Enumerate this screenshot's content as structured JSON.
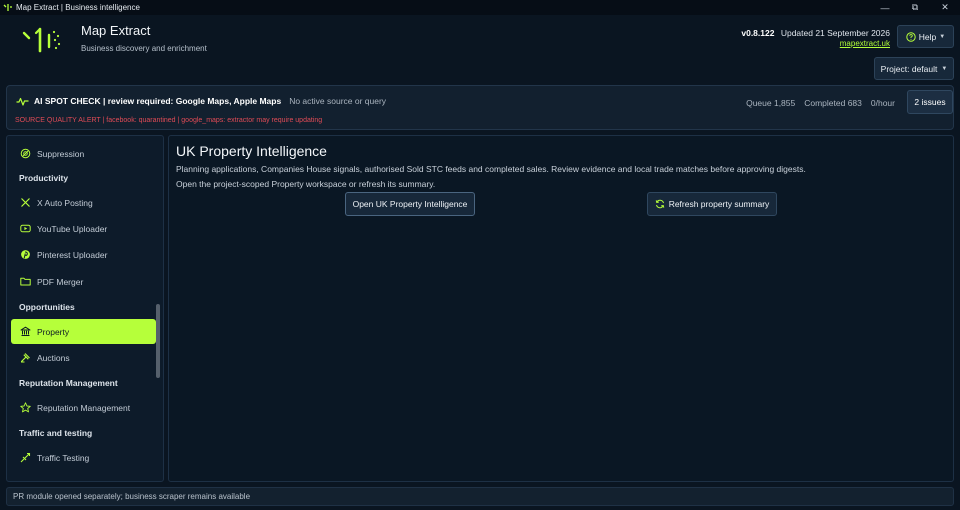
{
  "window": {
    "title": "Map Extract | Business intelligence",
    "minimize": "—",
    "maximize": "⧉",
    "close": "✕"
  },
  "header": {
    "app_name": "Map Extract",
    "tagline": "Business discovery and enrichment",
    "version": "v0.8.122",
    "updated": "Updated 21 September 2026",
    "site": "mapextract.uk",
    "help_label": "Help",
    "project_label": "Project: default"
  },
  "status": {
    "spot_check": "AI SPOT CHECK | review required: Google Maps, Apple Maps",
    "source_state": "No active source or query",
    "queue": "Queue 1,855",
    "completed": "Completed 683",
    "rate": "0/hour",
    "issues_label": "2 issues",
    "alert": "SOURCE QUALITY ALERT | facebook: quarantined | google_maps: extractor may require updating"
  },
  "sidebar": {
    "items": [
      {
        "type": "item",
        "label": "Suppression",
        "icon": "suppression-icon"
      },
      {
        "type": "group",
        "label": "Productivity"
      },
      {
        "type": "item",
        "label": "X Auto Posting",
        "icon": "x-icon"
      },
      {
        "type": "item",
        "label": "YouTube Uploader",
        "icon": "youtube-icon"
      },
      {
        "type": "item",
        "label": "Pinterest Uploader",
        "icon": "pinterest-icon"
      },
      {
        "type": "item",
        "label": "PDF Merger",
        "icon": "folder-icon"
      },
      {
        "type": "group",
        "label": "Opportunities"
      },
      {
        "type": "item",
        "label": "Property",
        "icon": "bank-icon",
        "active": true
      },
      {
        "type": "item",
        "label": "Auctions",
        "icon": "gavel-icon"
      },
      {
        "type": "group",
        "label": "Reputation Management"
      },
      {
        "type": "item",
        "label": "Reputation Management",
        "icon": "star-badge-icon"
      },
      {
        "type": "group",
        "label": "Traffic and testing"
      },
      {
        "type": "item",
        "label": "Traffic Testing",
        "icon": "traffic-icon"
      }
    ]
  },
  "main": {
    "title": "UK Property Intelligence",
    "description": "Planning applications, Companies House signals, authorised Sold STC feeds and completed sales. Review evidence and local trade matches before approving digests.",
    "hint": "Open the project-scoped Property workspace or refresh its summary.",
    "open_button": "Open UK Property Intelligence",
    "refresh_button": "Refresh property summary"
  },
  "statusbar": {
    "message": "PR module opened separately; business scraper remains available"
  },
  "colors": {
    "accent": "#b6ff3a",
    "alert": "#e04b56",
    "background": "#0a1521"
  }
}
